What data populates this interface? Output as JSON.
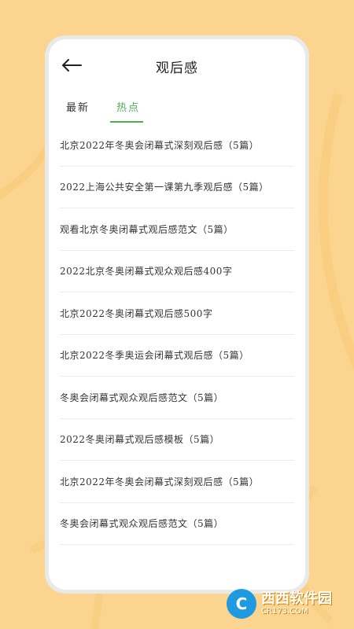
{
  "header": {
    "title": "观后感"
  },
  "tabs": [
    {
      "label": "最新"
    },
    {
      "label": "热点"
    }
  ],
  "items": [
    "北京2022年冬奥会闭幕式深刻观后感（5篇）",
    "2022上海公共安全第一课第九季观后感（5篇）",
    "观看北京冬奥闭幕式观后感范文（5篇）",
    "2022北京冬奥闭幕式观众观后感400字",
    "北京2022冬奥闭幕式观后感500字",
    "北京2022冬季奥运会闭幕式观后感（5篇）",
    "冬奥会闭幕式观众观后感范文（5篇）",
    "2022冬奥闭幕式观后感模板（5篇）",
    "北京2022年冬奥会闭幕式深刻观后感（5篇）",
    "冬奥会闭幕式观众观后感范文（5篇）"
  ],
  "watermark": {
    "logo": "C",
    "main": "西西软件园",
    "sub": "CR173.COM"
  },
  "colors": {
    "background": "#fbd58f",
    "accent": "#4caf50",
    "frame": "#e9e9e9"
  }
}
